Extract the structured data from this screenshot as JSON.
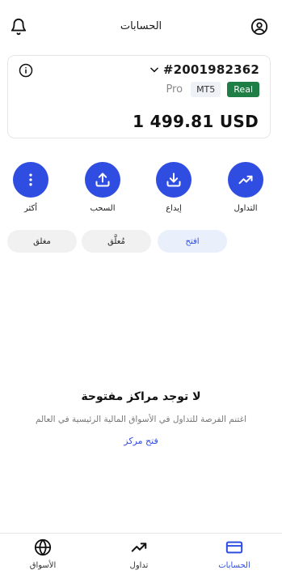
{
  "header": {
    "title": "الحسابات",
    "left_icon": "bell-icon",
    "right_icon": "user-circle-icon"
  },
  "account": {
    "id": "#2001982362",
    "type_label": "Pro",
    "platform_badge": "MT5",
    "mode_badge": "Real",
    "balance": "1 499.81 USD"
  },
  "actions": [
    {
      "label": "التداول",
      "icon": "trending-up-icon"
    },
    {
      "label": "إيداع",
      "icon": "download-icon"
    },
    {
      "label": "السحب",
      "icon": "upload-icon"
    },
    {
      "label": "أكثر",
      "icon": "more-vertical-icon"
    }
  ],
  "tabs": [
    {
      "label": "افتح",
      "active": true
    },
    {
      "label": "مُعلَّق",
      "active": false
    },
    {
      "label": "مغلق",
      "active": false
    }
  ],
  "empty_state": {
    "title": "لا توجد مراكز مفتوحة",
    "subtitle": "اغتنم الفرصة للتداول في الأسواق المالية الرئيسية في العالم",
    "link": "فتح مركز"
  },
  "bottom_nav": [
    {
      "label": "الحسابات",
      "icon": "card-icon",
      "active": true
    },
    {
      "label": "تداول",
      "icon": "trending-up-icon",
      "active": false
    },
    {
      "label": "الأسواق",
      "icon": "globe-icon",
      "active": false
    }
  ],
  "colors": {
    "accent": "#2f4de0",
    "real_badge": "#1e7e45",
    "mt5_badge": "#eef1f6",
    "active_tab_bg": "#e9effb"
  }
}
